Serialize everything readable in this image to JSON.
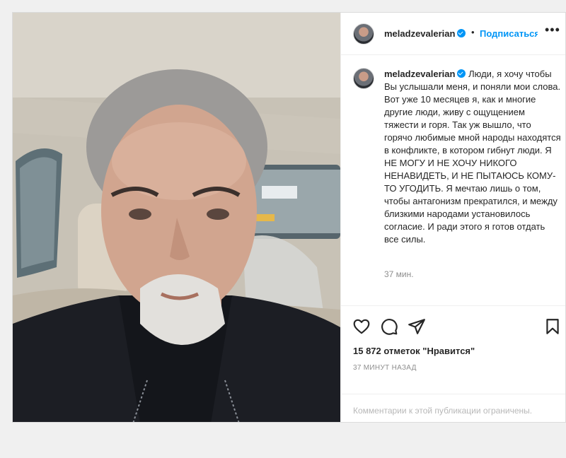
{
  "post": {
    "username": "meladzevalerian",
    "separator": "•",
    "follow_label": "Подписаться",
    "more_label": "•••",
    "caption": "Люди, я хочу чтобы Вы услышали меня, и поняли мои слова. Вот уже 10 месяцев я, как и многие другие люди, живу с ощущением тяжести и горя. Так уж вышло, что горячо любимые мной народы находятся в конфликте, в котором гибнут люди. Я НЕ МОГУ И НЕ ХОЧУ НИКОГО НЕНАВИДЕТЬ, И НЕ ПЫТАЮСЬ КОМУ-ТО УГОДИТЬ. Я мечтаю лишь о том, чтобы антагонизм прекратился, и между близкими народами установилось согласие. И ради этого я готов отдать все силы.",
    "caption_time": "37 мин.",
    "likes": "15 872 отметок \"Нравится\"",
    "posted_ago": "37 МИНУТ НАЗАД",
    "comments_notice": "Комментарии к этой публикации ограничены."
  },
  "icons": {
    "like": "heart-icon",
    "comment": "comment-icon",
    "share": "share-icon",
    "save": "bookmark-icon",
    "verified": "verified-badge-icon"
  },
  "colors": {
    "accent": "#0095f6",
    "text": "#262626",
    "muted": "#8e8e8e",
    "border": "#dbdbdb"
  }
}
